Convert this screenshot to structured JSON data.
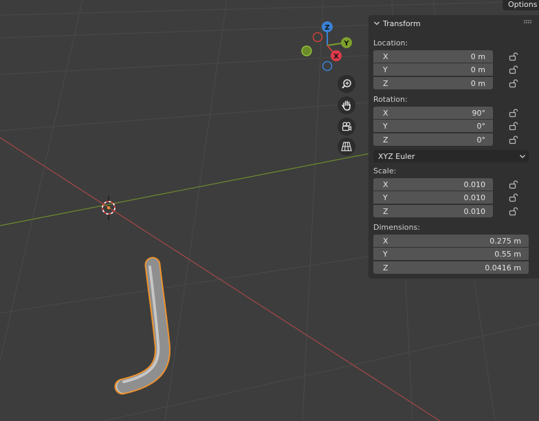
{
  "header": {
    "options_label": "Options"
  },
  "gizmo": {
    "z": "Z",
    "y": "Y",
    "x": "X"
  },
  "nav": [
    "zoom-icon",
    "pan-hand-icon",
    "camera-icon",
    "perspective-grid-icon"
  ],
  "panel": {
    "title": "Transform",
    "location": {
      "label": "Location:",
      "x_axis": "X",
      "x_value": "0 m",
      "y_axis": "Y",
      "y_value": "0 m",
      "z_axis": "Z",
      "z_value": "0 m"
    },
    "rotation": {
      "label": "Rotation:",
      "x_axis": "X",
      "x_value": "90°",
      "y_axis": "Y",
      "y_value": "0°",
      "z_axis": "Z",
      "z_value": "0°",
      "mode": "XYZ Euler"
    },
    "scale": {
      "label": "Scale:",
      "x_axis": "X",
      "x_value": "0.010",
      "y_axis": "Y",
      "y_value": "0.010",
      "z_axis": "Z",
      "z_value": "0.010"
    },
    "dimensions": {
      "label": "Dimensions:",
      "x_axis": "X",
      "x_value": "0.275 m",
      "y_axis": "Y",
      "y_value": "0.55 m",
      "z_axis": "Z",
      "z_value": "0.0416 m"
    }
  },
  "colors": {
    "background": "#3d3d3d",
    "x_axis": "#c9423b",
    "y_axis": "#7ea02c",
    "z_axis": "#3a82d6",
    "selection_outline": "#f0922a"
  }
}
